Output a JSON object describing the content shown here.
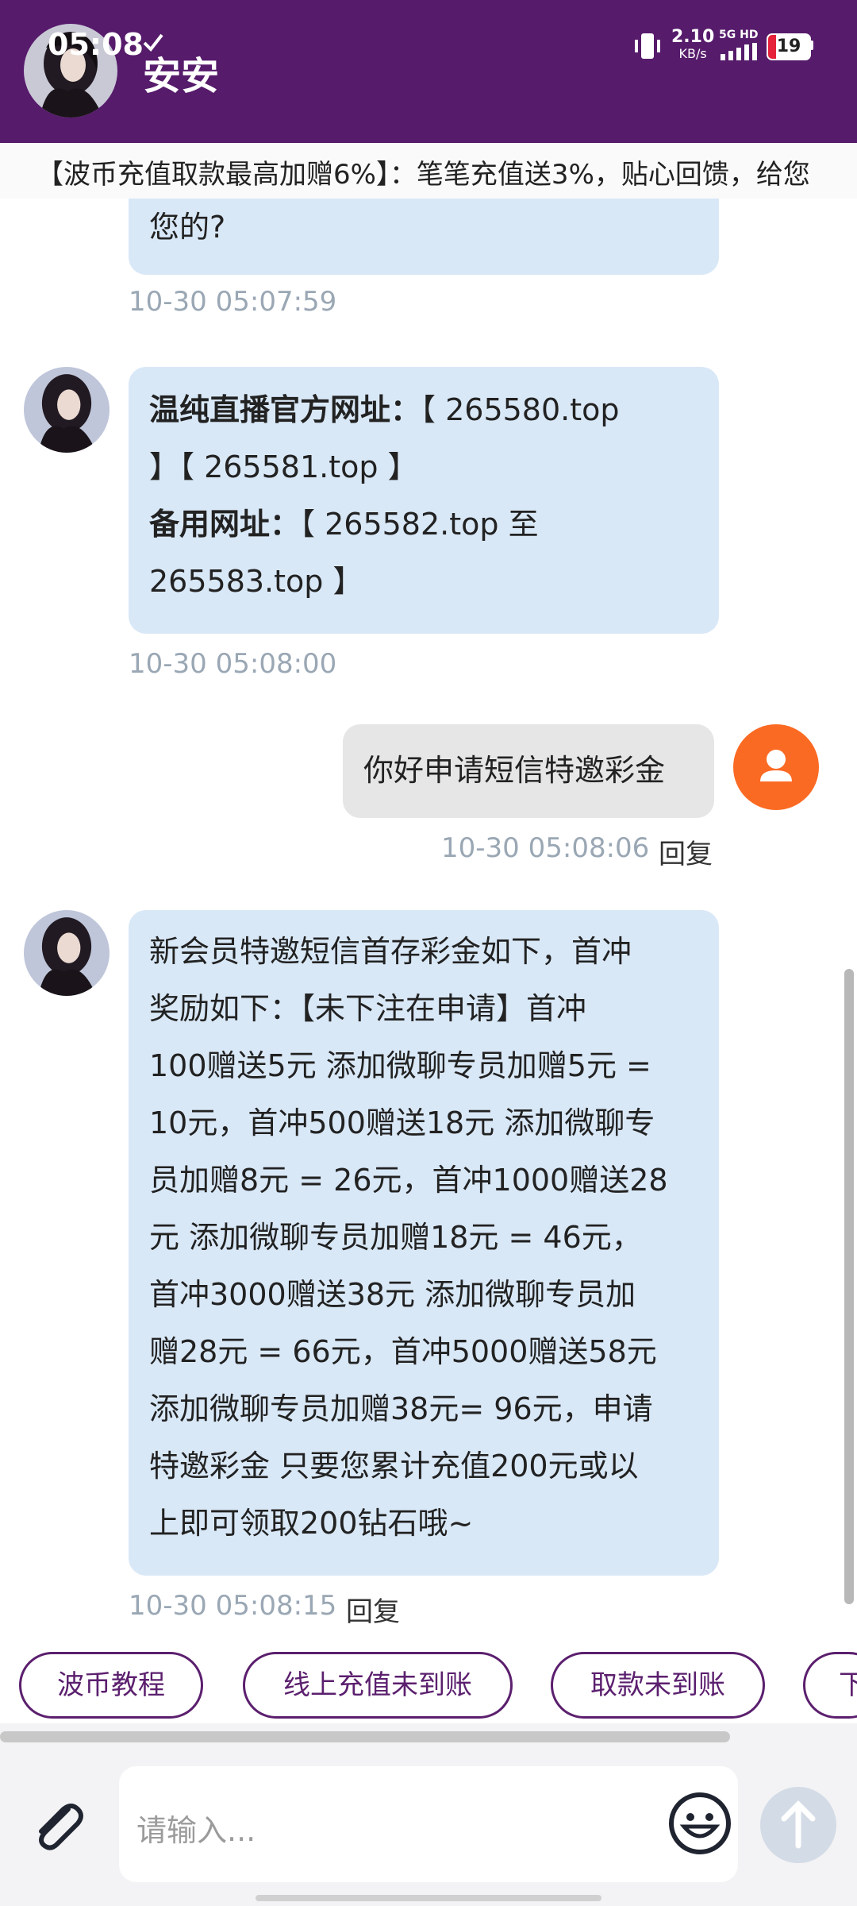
{
  "status_bar": {
    "time": "05:08",
    "net_speed_value": "2.10",
    "net_speed_unit": "KB/s",
    "signal_label": "5G HD",
    "battery": "19",
    "battery_level": 0.19
  },
  "header": {
    "title": "安安"
  },
  "marquee": {
    "text": "【波币充值取款最高加赠6%】：笔笔充值送3%，贴心回馈，给您"
  },
  "messages": {
    "m1": {
      "text": "您的?",
      "time": "10-30 05:07:59"
    },
    "m2": {
      "line1_bold": "温纯直播官方网址：",
      "line1_rest": "【 265580.top",
      "line2": "】【 265581.top 】",
      "line3_bold": "备用网址：",
      "line3_rest": "【 265582.top 至",
      "line4": "265583.top 】",
      "time": "10-30 05:08:00"
    },
    "m3": {
      "text": "你好申请短信特邀彩金",
      "time": "10-30 05:08:06",
      "reply": "回复"
    },
    "m4": {
      "lines": [
        "新会员特邀短信首存彩金如下，首冲",
        "奖励如下：【未下注在申请】首冲",
        "100赠送5元 添加微聊专员加赠5元 =",
        "10元，首冲500赠送18元 添加微聊专",
        "员加赠8元 = 26元，首冲1000赠送28",
        "元 添加微聊专员加赠18元 = 46元，",
        "首冲3000赠送38元 添加微聊专员加",
        "赠28元 = 66元，首冲5000赠送58元",
        "添加微聊专员加赠38元= 96元，申请",
        "特邀彩金 只要您累计充值200元或以",
        "上即可领取200钻石哦~"
      ],
      "time": "10-30 05:08:15",
      "reply": "回复"
    }
  },
  "quick_replies": [
    "波币教程",
    "线上充值未到账",
    "取款未到账",
    "下"
  ],
  "input": {
    "placeholder": "请输入..."
  },
  "colors": {
    "header": "#561b6b",
    "bubble_in": "#d9e8f7",
    "bubble_out": "#e6e6e6",
    "user_avatar": "#fb6a23",
    "chip": "#5b1f6e"
  }
}
